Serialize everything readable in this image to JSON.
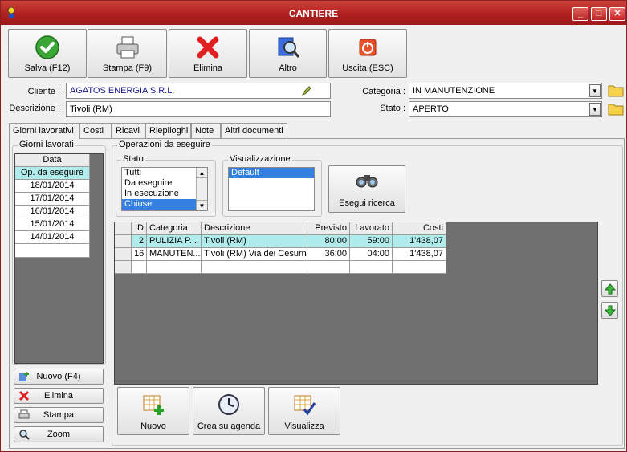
{
  "window": {
    "title": "CANTIERE",
    "controls": [
      "_",
      "□",
      "✕"
    ]
  },
  "toolbar": [
    {
      "label": "Salva (F12)",
      "icon": "check-icon",
      "name": "save-button"
    },
    {
      "label": "Stampa (F9)",
      "icon": "printer-icon",
      "name": "print-button"
    },
    {
      "label": "Elimina",
      "icon": "delete-x-icon",
      "name": "delete-button"
    },
    {
      "label": "Altro",
      "icon": "search-document-icon",
      "name": "other-button"
    },
    {
      "label": "Uscita (ESC)",
      "icon": "power-icon",
      "name": "exit-button"
    }
  ],
  "form": {
    "cliente_label": "Cliente :",
    "cliente_value": "AGATOS ENERGIA S.R.L.",
    "descrizione_label": "Descrizione :",
    "descrizione_value": "Tivoli (RM)",
    "categoria_label": "Categoria :",
    "categoria_value": "IN MANUTENZIONE",
    "stato_label": "Stato :",
    "stato_value": "APERTO"
  },
  "tabs": [
    "Giorni lavorativi",
    "Costi",
    "Ricavi",
    "Riepiloghi",
    "Note",
    "Altri documenti"
  ],
  "giorni": {
    "title": "Giorni lavorati",
    "header": "Data",
    "rows": [
      "Op. da eseguire",
      "18/01/2014",
      "17/01/2014",
      "16/01/2014",
      "15/01/2014",
      "14/01/2014"
    ],
    "buttons": [
      "Nuovo (F4)",
      "Elimina",
      "Stampa",
      "Zoom"
    ]
  },
  "operazioni": {
    "title": "Operazioni da eseguire",
    "stato_title": "Stato",
    "stato_items": [
      "Tutti",
      "Da eseguire",
      "In esecuzione",
      "Chiuse"
    ],
    "stato_selected": 3,
    "vis_title": "Visualizzazione",
    "vis_items": [
      "Default"
    ],
    "search_label": "Esegui ricerca",
    "columns": [
      "ID",
      "Categoria",
      "Descrizione",
      "Previsto",
      "Lavorato",
      "Costi"
    ],
    "rows": [
      [
        "2",
        "PULIZIA P...",
        "Tivoli (RM)",
        "80:00",
        "59:00",
        "1'438,07"
      ],
      [
        "16",
        "MANUTEN...",
        "Tivoli (RM) Via dei Cesurni",
        "36:00",
        "04:00",
        "1'438,07"
      ]
    ],
    "buttons": [
      "Nuovo",
      "Crea su agenda",
      "Visualizza"
    ]
  },
  "colors": {
    "title_bar": "#b02020",
    "selection": "#3380e0",
    "selected_row": "#b0ecec",
    "client_text": "#1a1a8c"
  }
}
